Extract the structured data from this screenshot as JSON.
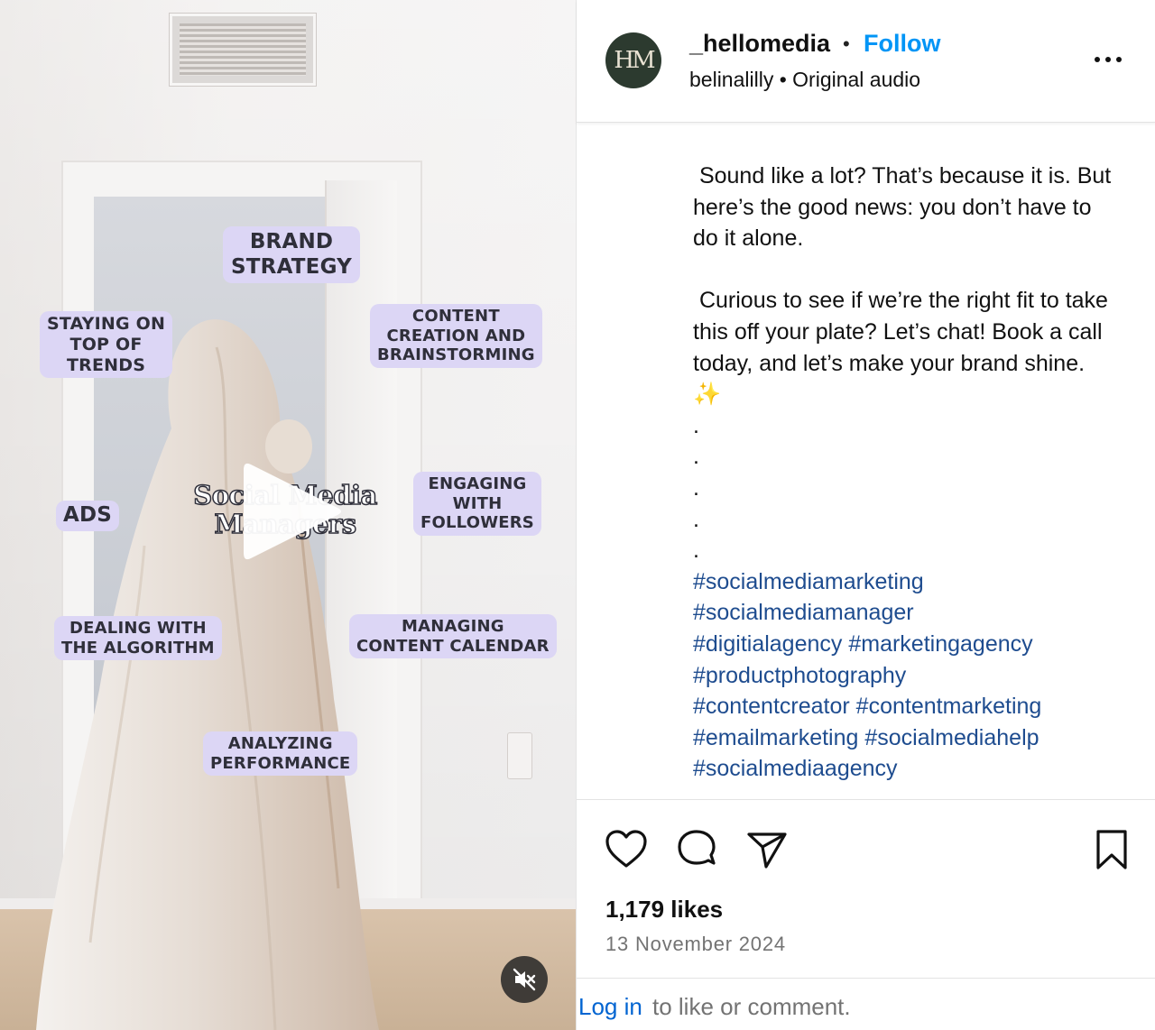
{
  "post": {
    "username": "_hellomedia",
    "separator": "•",
    "follow_label": "Follow",
    "subline": "belinalilly • Original audio",
    "avatar_initials": "HM"
  },
  "video": {
    "labels": {
      "brand": "BRAND\nSTRATEGY",
      "content": "CONTENT\nCREATION AND\nBRAINSTORMING",
      "staying": "STAYING ON\nTOP OF\nTRENDS",
      "ads": "ADS",
      "engaging": "ENGAGING\nWITH\nFOLLOWERS",
      "algorithm": "DEALING WITH\nTHE ALGORITHM",
      "calendar": "MANAGING\nCONTENT CALENDAR",
      "analyzing": "ANALYZING\nPERFORMANCE"
    },
    "center_title": "Social Media\nManagers",
    "play_icon": "play-icon",
    "mute_icon": "muted-speaker-icon"
  },
  "caption": {
    "paragraph1": " Sound like a lot? That’s because it is. But here’s the good news: you don’t have to do it alone.",
    "paragraph2": " Curious to see if we’re the right fit to take this off your plate? Let’s chat! Book a call today, and let’s make your brand shine.",
    "sparkle": "✨",
    "dots": [
      ".",
      ".",
      ".",
      ".",
      "."
    ],
    "hashtags": [
      "#socialmediamarketing",
      "#socialmediamanager",
      "#digitialagency #marketingagency",
      "#productphotography",
      "#contentcreator #contentmarketing",
      "#emailmarketing #socialmediahelp",
      "#socialmediaagency"
    ]
  },
  "actions": {
    "likes": "1,179 likes",
    "date": "13 November 2024",
    "login_link": "Log in",
    "login_rest": "to like or comment."
  },
  "colors": {
    "follow": "#0095f6",
    "hashtag": "#1e4c8f",
    "bubble": "#dcd6f5",
    "avatar_bg": "#2c3a2f"
  }
}
